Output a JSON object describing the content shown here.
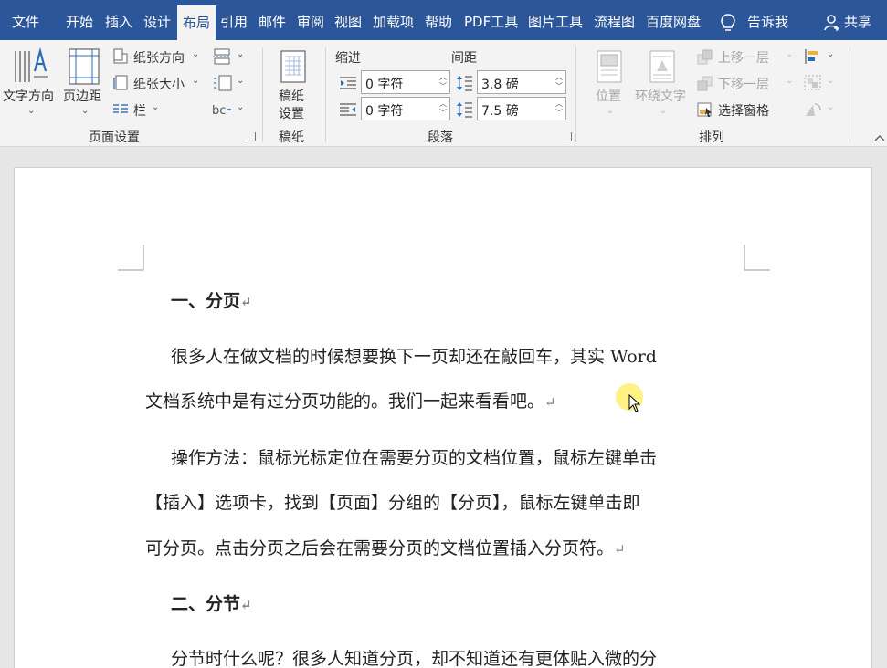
{
  "tabs": [
    "文件",
    "开始",
    "插入",
    "设计",
    "布局",
    "引用",
    "邮件",
    "审阅",
    "视图",
    "加载项",
    "帮助",
    "PDF工具",
    "图片工具",
    "流程图",
    "百度网盘"
  ],
  "tell_me": "告诉我",
  "share": "共享",
  "ribbon": {
    "page_setup": {
      "text_direction": "文字方向",
      "margins": "页边距",
      "orientation": "纸张方向",
      "size": "纸张大小",
      "columns": "栏",
      "group_label": "页面设置"
    },
    "manuscript": {
      "button": "稿纸\n设置",
      "button_line1": "稿纸",
      "button_line2": "设置",
      "group_label": "稿纸"
    },
    "paragraph": {
      "indent_label": "缩进",
      "spacing_label": "间距",
      "indent_left": "0 字符",
      "indent_right": "0 字符",
      "spacing_before": "3.8 磅",
      "spacing_after": "7.5 磅",
      "group_label": "段落"
    },
    "arrange": {
      "position": "位置",
      "wrap_text": "环绕文字",
      "bring_forward": "上移一层",
      "send_backward": "下移一层",
      "selection_pane": "选择窗格",
      "group_label": "排列"
    }
  },
  "document": {
    "heading1": "一、分页",
    "para1_line1": "很多人在做文档的时候想要换下一页却还在敲回车，其实 Word",
    "para1_line2": "文档系统中是有过分页功能的。我们一起来看看吧。",
    "para2_line1": "操作方法：鼠标光标定位在需要分页的文档位置，鼠标左键单击",
    "para2_line2": "【插入】选项卡，找到【页面】分组的【分页】，鼠标左键单击即",
    "para2_line3": "可分页。点击分页之后会在需要分页的文档位置插入分页符。",
    "heading2": "二、分节",
    "para3_line1": "分节时什么呢？很多人知道分页，却不知道还有更体贴入微的分",
    "paragraph_mark": "↵"
  },
  "colors": {
    "tab_bar": "#2b579a",
    "ribbon_bg": "#f3f3f3",
    "canvas_bg": "#e6e6e6",
    "page_bg": "#ffffff",
    "cursor_highlight": "#ffec5a"
  }
}
